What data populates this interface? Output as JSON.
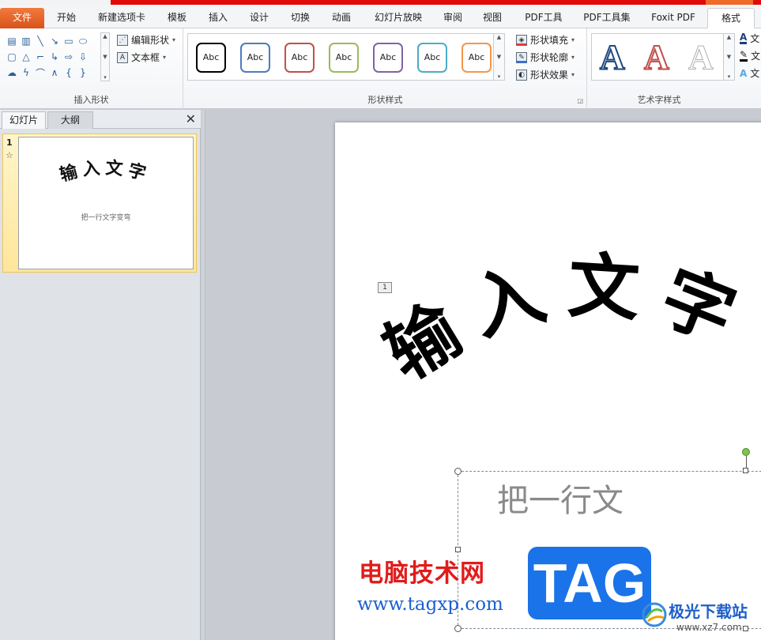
{
  "colors": {
    "accent": "#e00a0a",
    "file_tab": "#e86a2c",
    "tag_blue": "#1a73e8",
    "wm_red": "#e11b1b",
    "wm_url": "#1b5fd1"
  },
  "tabs": [
    "文件",
    "开始",
    "新建选项卡",
    "模板",
    "插入",
    "设计",
    "切换",
    "动画",
    "幻灯片放映",
    "审阅",
    "视图",
    "PDF工具",
    "PDF工具集",
    "Foxit PDF",
    "格式"
  ],
  "ribbon": {
    "insert_shapes": {
      "label": "插入形状",
      "edit_shape": "编辑形状",
      "text_box": "文本框"
    },
    "shape_styles": {
      "label": "形状样式",
      "abc": "Abc",
      "fill": "形状填充",
      "outline": "形状轮廓",
      "effects": "形状效果"
    },
    "wordart_styles": {
      "label": "艺术字样式",
      "letter": "A",
      "side_items": [
        "文",
        "文",
        "文"
      ]
    }
  },
  "left_pane": {
    "tabs": [
      "幻灯片",
      "大纲"
    ],
    "close": "✕",
    "slide_number": "1",
    "star": "☆",
    "thumb_title": "输入文字",
    "thumb_subtitle": "把一行文字变弯"
  },
  "slide": {
    "placeholder_number": "1",
    "title_text": "输入文字",
    "subtitle_text": "把一行文"
  },
  "watermark": {
    "title": "电脑技术网",
    "url": "www.tagxp.com",
    "badge": "TAG",
    "site": "极光下载站",
    "site_url": "www.xz7.com"
  }
}
